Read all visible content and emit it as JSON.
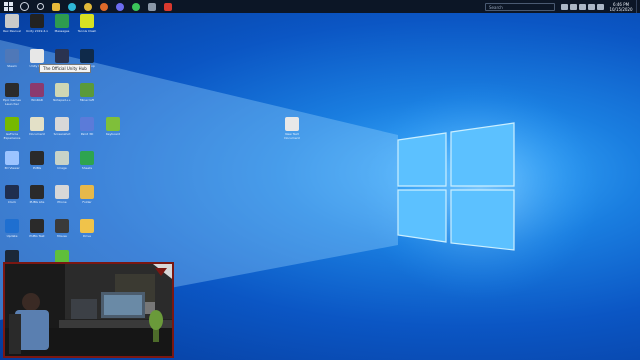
{
  "taskbar": {
    "search_placeholder": "Search",
    "clock_time": "6:46 PM",
    "clock_date": "10/15/2020",
    "apps": [
      {
        "icon": "file-explorer-icon",
        "color": "#e8b93a"
      },
      {
        "icon": "edge-icon",
        "color": "#2fb8d8"
      },
      {
        "icon": "chrome-icon",
        "color": "#e0b83a"
      },
      {
        "icon": "firefox-icon",
        "color": "#e06a2a"
      },
      {
        "icon": "messenger-icon",
        "color": "#6d6cf0"
      },
      {
        "icon": "whatsapp-icon",
        "color": "#3bc55b"
      },
      {
        "icon": "settings-icon",
        "color": "#8a97a8"
      },
      {
        "icon": "record-icon",
        "color": "#d9392e"
      }
    ]
  },
  "tooltip": "The Official Unity Hub",
  "desktop_icons": [
    {
      "name": "user-folder-icon",
      "label": "Rex Pascual",
      "color": "#c9c9c9"
    },
    {
      "name": "unity-icon",
      "label": "Unity 2019.4.x",
      "color": "#222222"
    },
    {
      "name": "messages-icon",
      "label": "Messages",
      "color": "#2e9b4f"
    },
    {
      "name": "tennis-icon",
      "label": "Tennis Clash",
      "color": "#d8e322"
    },
    {
      "name": "steam-desktop-icon",
      "label": "Steam",
      "color": "#4f78b8"
    },
    {
      "name": "unity-hub-icon",
      "label": "Unity Hub",
      "color": "#e7e7e7"
    },
    {
      "name": "shield-icon",
      "label": "Defender",
      "color": "#2a3350"
    },
    {
      "name": "photoshop-icon",
      "label": "Photoshop",
      "color": "#0f2a4a"
    },
    {
      "name": "epic-games-icon",
      "label": "Epic Games Launcher",
      "color": "#2b2b2b"
    },
    {
      "name": "winrar-icon",
      "label": "WinRAR",
      "color": "#8b3a6e"
    },
    {
      "name": "notepad-icon",
      "label": "Notepad++",
      "color": "#cfd7b4"
    },
    {
      "name": "game-icon",
      "label": "Minecraft",
      "color": "#5a9a3a"
    },
    {
      "name": "nvidia-icon",
      "label": "GeForce Experience",
      "color": "#76b900"
    },
    {
      "name": "document-icon",
      "label": "Document",
      "color": "#e3e0c7"
    },
    {
      "name": "doc2-icon",
      "label": "Screenshot",
      "color": "#d8d8d8"
    },
    {
      "name": "paint-icon",
      "label": "Paint 3D",
      "color": "#5b7bd9"
    },
    {
      "name": "keyboard-icon",
      "label": "Keyboard",
      "color": "#7fbf3a"
    },
    {
      "name": "cube-icon",
      "label": "3D Viewer",
      "color": "#9cc4ff"
    },
    {
      "name": "pubg-icon",
      "label": "PUBG",
      "color": "#2a2a2a"
    },
    {
      "name": "image-icon",
      "label": "Image",
      "color": "#c8d3c8"
    },
    {
      "name": "sheets-icon",
      "label": "Sheets",
      "color": "#2ea44f"
    },
    {
      "name": "clock-icon",
      "label": "Clock",
      "color": "#1f2e4e"
    },
    {
      "name": "pubg2-icon",
      "label": "PUBG Lite",
      "color": "#2a2a2a"
    },
    {
      "name": "phone-icon",
      "label": "Phone",
      "color": "#d7d7d7"
    },
    {
      "name": "folder-icon",
      "label": "Folder",
      "color": "#e6b84a"
    },
    {
      "name": "update-icon",
      "label": "Update",
      "color": "#1f6fd0"
    },
    {
      "name": "pubg3-icon",
      "label": "PUBG Test",
      "color": "#2a2a2a"
    },
    {
      "name": "mouse-icon",
      "label": "Mouse",
      "color": "#3a3a3a"
    },
    {
      "name": "drive-icon",
      "label": "Drive",
      "color": "#f0c34a"
    },
    {
      "name": "steam2-icon",
      "label": "Steam",
      "color": "#1b2838"
    },
    {
      "name": "leaf-icon",
      "label": "Green",
      "color": "#5fbf3a"
    },
    {
      "name": "text-file-icon",
      "label": "New Text Document",
      "color": "#e8e8e8"
    }
  ]
}
